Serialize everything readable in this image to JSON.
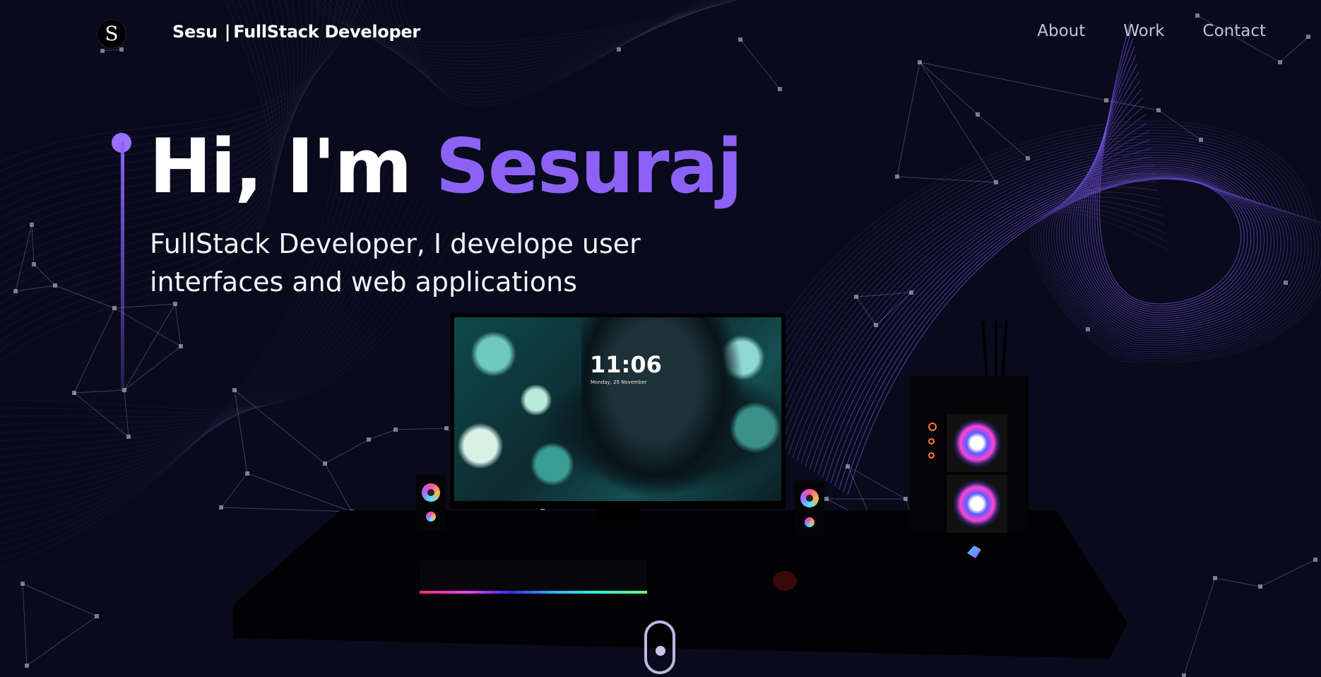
{
  "header": {
    "logo_letter": "S",
    "brand_name": "Sesu",
    "brand_separator": "|",
    "brand_role": "FullStack Developer",
    "nav": [
      "About",
      "Work",
      "Contact"
    ]
  },
  "hero": {
    "greeting": "Hi, I'm",
    "name": "Sesuraj",
    "subtitle": "FullStack Developer, I develope user interfaces and web applications"
  },
  "monitor": {
    "clock": "11:06",
    "date": "Monday, 25 November"
  },
  "colors": {
    "background": "#090a1b",
    "accent": "#8c62f4",
    "nav_text": "#c4c1dc"
  },
  "icons": {
    "scroll_indicator": "mouse-scroll-icon"
  }
}
